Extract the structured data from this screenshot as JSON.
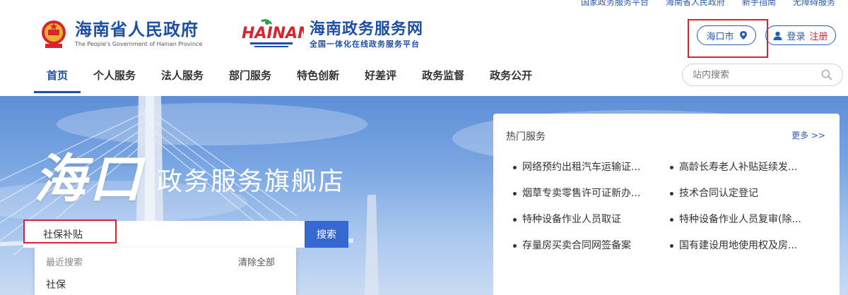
{
  "top_links": [
    "国家政务服务平台",
    "海南省人民政府",
    "新手指南",
    "无障碍服务"
  ],
  "logo_gov": {
    "title": "海南省人民政府",
    "subtitle": "The People's Government of Hainan Province"
  },
  "logo_service": {
    "mark_text": "HAINAN",
    "title": "海南政务服务网",
    "subtitle": "全国一体化在线政务服务平台"
  },
  "location": {
    "label": "海口市"
  },
  "auth": {
    "login": "登录",
    "register": "注册"
  },
  "nav": {
    "items": [
      "首页",
      "个人服务",
      "法人服务",
      "部门服务",
      "特色创新",
      "好差评",
      "政务监督",
      "政务公开"
    ],
    "active": "首页",
    "search_placeholder": "站内搜索"
  },
  "banner": {
    "title_big": "海口",
    "title_small": "政务服务旗舰店",
    "search_value": "社保补贴",
    "search_button": "搜索",
    "dropdown": {
      "header": "最近搜索",
      "clear": "清除全部",
      "items": [
        "社保"
      ]
    }
  },
  "hot_services": {
    "title": "热门服务",
    "more": "更多 >>",
    "items": [
      "网络预约出租汽车运输证...",
      "高龄长寿老人补贴延续发...",
      "烟草专卖零售许可证新办...",
      "技术合同认定登记",
      "特种设备作业人员取证",
      "特种设备作业人员复审(除...",
      "存量房买卖合同网签备案",
      "国有建设用地使用权及房..."
    ]
  },
  "colors": {
    "brand_blue": "#1d4ea8",
    "highlight_red": "#d9232e",
    "search_button": "#3669cf"
  }
}
